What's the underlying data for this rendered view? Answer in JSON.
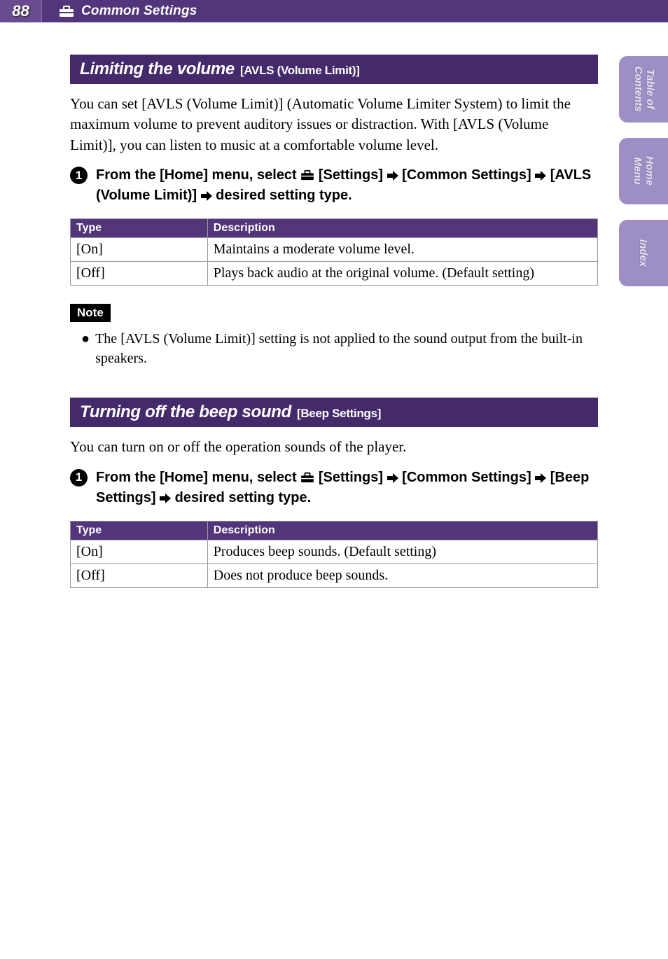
{
  "header": {
    "page_number": "88",
    "breadcrumb": "Common Settings"
  },
  "side_tabs": {
    "toc": "Table of\nContents",
    "home": "Home\nMenu",
    "index": "Index"
  },
  "section1": {
    "heading_main": "Limiting the volume",
    "heading_sub": "[AVLS (Volume Limit)]",
    "intro": "You can set [AVLS (Volume Limit)] (Automatic Volume Limiter System) to limit the maximum volume to prevent auditory issues or distraction. With [AVLS (Volume Limit)], you can listen to music at a comfortable volume level.",
    "step_num": "1",
    "step_part1": "From the [Home] menu, select ",
    "step_settings": " [Settings] ",
    "step_common": " [Common Settings] ",
    "step_avls": " [AVLS (Volume Limit)] ",
    "step_end": " desired setting type.",
    "table": {
      "col1": "Type",
      "col2": "Description",
      "rows": [
        {
          "type": "[On]",
          "desc": "Maintains a moderate volume level."
        },
        {
          "type": "[Off]",
          "desc": "Plays back audio at the original volume. (Default setting)"
        }
      ]
    },
    "note_label": "Note",
    "note_text": "The [AVLS (Volume Limit)] setting is not applied to the sound output from the built-in speakers."
  },
  "section2": {
    "heading_main": "Turning off the beep sound",
    "heading_sub": "[Beep Settings]",
    "intro": "You can turn on or off the operation sounds of the player.",
    "step_num": "1",
    "step_part1": "From the [Home] menu, select ",
    "step_settings": " [Settings] ",
    "step_common": " [Common Settings] ",
    "step_beep": " [Beep Settings] ",
    "step_end": " desired setting type.",
    "table": {
      "col1": "Type",
      "col2": "Description",
      "rows": [
        {
          "type": "[On]",
          "desc": "Produces beep sounds. (Default setting)"
        },
        {
          "type": "[Off]",
          "desc": "Does not produce beep sounds."
        }
      ]
    }
  }
}
